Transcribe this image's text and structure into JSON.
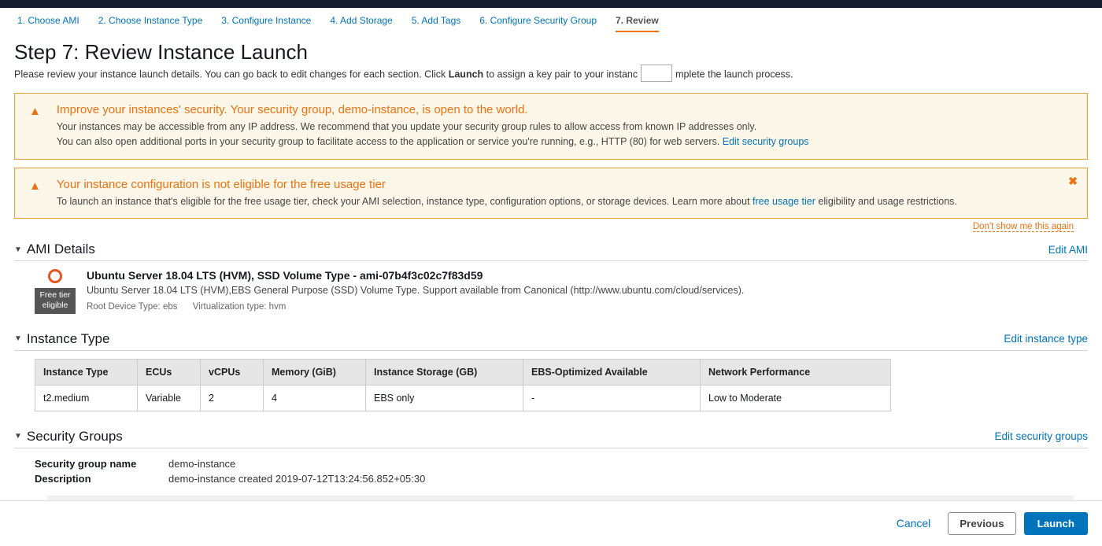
{
  "wizard": {
    "steps": [
      "1. Choose AMI",
      "2. Choose Instance Type",
      "3. Configure Instance",
      "4. Add Storage",
      "5. Add Tags",
      "6. Configure Security Group",
      "7. Review"
    ]
  },
  "header": {
    "title": "Step 7: Review Instance Launch",
    "subtitle_pre": "Please review your instance launch details. You can go back to edit changes for each section. Click ",
    "subtitle_bold": "Launch",
    "subtitle_mid": " to assign a key pair to your instanc",
    "subtitle_post": "mplete the launch process."
  },
  "alert1": {
    "title": "Improve your instances' security. Your security group, demo-instance, is open to the world.",
    "line1": "Your instances may be accessible from any IP address. We recommend that you update your security group rules to allow access from known IP addresses only.",
    "line2_pre": "You can also open additional ports in your security group to facilitate access to the application or service you're running, e.g., HTTP (80) for web servers. ",
    "link": "Edit security groups"
  },
  "alert2": {
    "title": "Your instance configuration is not eligible for the free usage tier",
    "text_pre": "To launch an instance that's eligible for the free usage tier, check your AMI selection, instance type, configuration options, or storage devices. Learn more about ",
    "link": "free usage tier",
    "text_post": " eligibility and usage restrictions."
  },
  "dont_show": "Don't show me this again",
  "ami": {
    "section_title": "AMI Details",
    "edit_link": "Edit AMI",
    "title": "Ubuntu Server 18.04 LTS (HVM), SSD Volume Type - ami-07b4f3c02c7f83d59",
    "desc": "Ubuntu Server 18.04 LTS (HVM),EBS General Purpose (SSD) Volume Type. Support available from Canonical (http://www.ubuntu.com/cloud/services).",
    "root_device": "Root Device Type: ebs",
    "virt_type": "Virtualization type: hvm",
    "badge_line1": "Free tier",
    "badge_line2": "eligible"
  },
  "instance_type": {
    "section_title": "Instance Type",
    "edit_link": "Edit instance type",
    "headers": [
      "Instance Type",
      "ECUs",
      "vCPUs",
      "Memory (GiB)",
      "Instance Storage (GB)",
      "EBS-Optimized Available",
      "Network Performance"
    ],
    "row": [
      "t2.medium",
      "Variable",
      "2",
      "4",
      "EBS only",
      "-",
      "Low to Moderate"
    ]
  },
  "security_groups": {
    "section_title": "Security Groups",
    "edit_link": "Edit security groups",
    "name_label": "Security group name",
    "name_value": "demo-instance",
    "desc_label": "Description",
    "desc_value": "demo-instance created 2019-07-12T13:24:56.852+05:30"
  },
  "footer": {
    "cancel": "Cancel",
    "previous": "Previous",
    "launch": "Launch"
  }
}
